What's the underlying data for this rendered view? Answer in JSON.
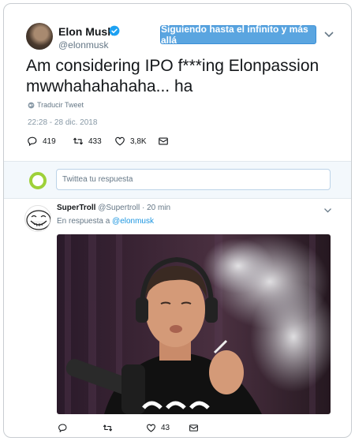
{
  "tweet": {
    "author_name": "Elon Musk",
    "author_handle": "@elonmusk",
    "follow_label": "Siguiendo hasta el infinito y más allá",
    "text_line1": "Am considering IPO f***ing Elonpassion",
    "text_line2": "mwwhahahahaha... ha",
    "translate_label": "Traducir Tweet",
    "timestamp": "22:28 - 28 dic. 2018",
    "actions": {
      "replies": "419",
      "retweets": "433",
      "likes": "3,8K"
    }
  },
  "reply_box": {
    "placeholder": "Twittea tu respuesta"
  },
  "reply": {
    "author_name": "SuperTroll",
    "author_handle": "@Supertroll",
    "time": "· 20 min",
    "in_reply_prefix": "En respuesta a",
    "in_reply_handle": "@elonmusk",
    "actions": {
      "replies": "",
      "retweets": "",
      "likes": "43"
    }
  },
  "icons": {
    "verified": "verified-badge-icon",
    "caret": "chevron-down-icon",
    "reply": "reply-icon",
    "retweet": "retweet-icon",
    "like": "heart-icon",
    "dm": "envelope-icon",
    "translate": "globe-icon"
  },
  "colors": {
    "follow_button": "#5aa5e0",
    "link": "#1b95e0",
    "verified": "#1da1f2",
    "reply_avatar_ring": "#9ed139"
  }
}
